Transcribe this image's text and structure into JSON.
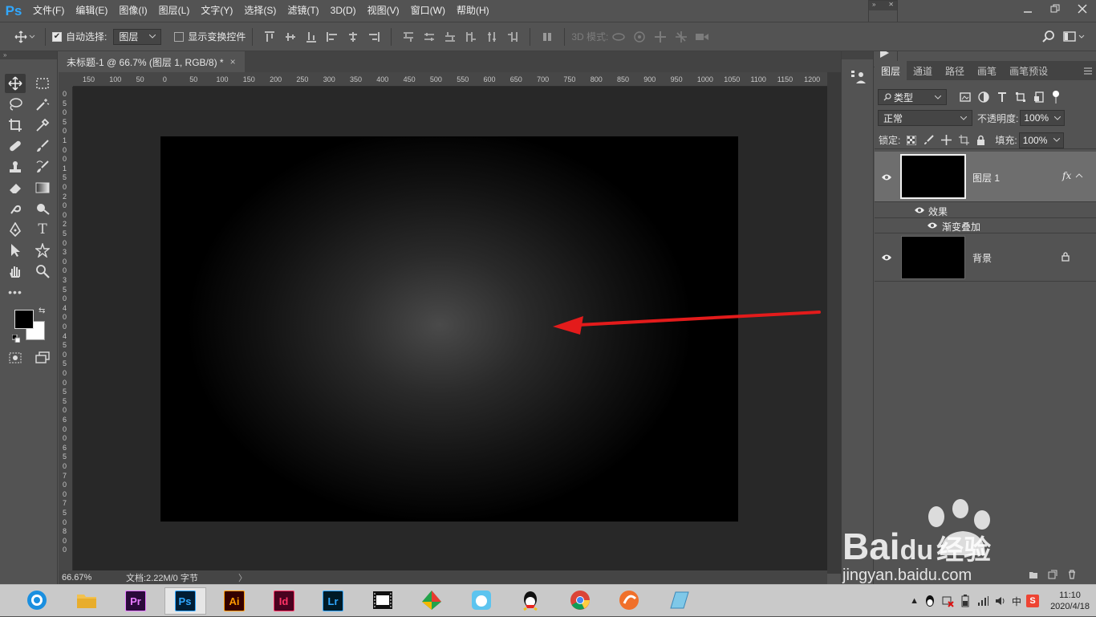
{
  "app": {
    "logo": "Ps",
    "accent": "#31a8ff"
  },
  "menu": [
    "文件(F)",
    "编辑(E)",
    "图像(I)",
    "图层(L)",
    "文字(Y)",
    "选择(S)",
    "滤镜(T)",
    "3D(D)",
    "视图(V)",
    "窗口(W)",
    "帮助(H)"
  ],
  "options": {
    "auto_select_label": "自动选择:",
    "auto_select_checked": true,
    "auto_select_target": "图层",
    "show_transform_label": "显示变换控件",
    "show_transform_checked": false,
    "mode_3d_label": "3D 模式:"
  },
  "document": {
    "tab_title": "未标题-1 @ 66.7% (图层 1, RGB/8) *",
    "close_glyph": "×",
    "zoom": "66.67%",
    "doc_info": "文档:2.22M/0 字节",
    "status_arrow": "〉",
    "ruler_top": [
      "150",
      "100",
      "50",
      "0",
      "50",
      "100",
      "150",
      "200",
      "250",
      "300",
      "350",
      "400",
      "450",
      "500",
      "550",
      "600",
      "650",
      "700",
      "750",
      "800",
      "850",
      "900",
      "950",
      "1000",
      "1050",
      "1100",
      "1150",
      "1200"
    ],
    "ruler_left": [
      "0",
      "5",
      "0",
      "5",
      "0",
      "1",
      "0",
      "0",
      "1",
      "5",
      "0",
      "2",
      "0",
      "0",
      "2",
      "5",
      "0",
      "3",
      "0",
      "0",
      "3",
      "5",
      "0",
      "4",
      "0",
      "0",
      "4",
      "5",
      "0",
      "5",
      "0",
      "0",
      "5",
      "5",
      "0",
      "6",
      "0",
      "0",
      "6",
      "5",
      "0",
      "7",
      "0",
      "0",
      "7",
      "5",
      "0",
      "8",
      "0",
      "0"
    ]
  },
  "annotation": {
    "arrow_color": "#e31b1b"
  },
  "layers_panel": {
    "tabs": [
      "图层",
      "通道",
      "路径",
      "画笔",
      "画笔预设"
    ],
    "active_tab": "图层",
    "filter_kind": "类型",
    "blend_mode": "正常",
    "opacity_label": "不透明度:",
    "opacity": "100%",
    "lock_label": "锁定:",
    "fill_label": "填充:",
    "fill": "100%",
    "layers": [
      {
        "name": "图层 1",
        "fx": "fx",
        "selected": true,
        "effects_label": "效果",
        "effects": [
          "渐变叠加"
        ]
      },
      {
        "name": "背景",
        "locked": true
      }
    ]
  },
  "taskbar": {
    "apps": [
      {
        "name": "browser-360",
        "label": ""
      },
      {
        "name": "file-explorer",
        "label": ""
      },
      {
        "name": "premiere",
        "label": "Pr",
        "bg": "#2a0a3a",
        "fg": "#e77bff"
      },
      {
        "name": "photoshop",
        "label": "Ps",
        "bg": "#001d34",
        "fg": "#31a8ff",
        "active": true
      },
      {
        "name": "illustrator",
        "label": "Ai",
        "bg": "#330000",
        "fg": "#ff9a00"
      },
      {
        "name": "indesign",
        "label": "Id",
        "bg": "#49021f",
        "fg": "#ff3366"
      },
      {
        "name": "lightroom",
        "label": "Lr",
        "bg": "#001a26",
        "fg": "#30a8ff"
      },
      {
        "name": "video-editor",
        "label": ""
      },
      {
        "name": "app-colorful",
        "label": ""
      },
      {
        "name": "app-bird",
        "label": ""
      },
      {
        "name": "qq",
        "label": ""
      },
      {
        "name": "chrome",
        "label": ""
      },
      {
        "name": "app-orange",
        "label": ""
      },
      {
        "name": "app-note",
        "label": ""
      }
    ],
    "time": "11:10",
    "date": "2020/4/18"
  },
  "watermark": {
    "brand": "Bai",
    "brand2": "du",
    "suffix": "经验",
    "url": "jingyan.baidu.com"
  }
}
